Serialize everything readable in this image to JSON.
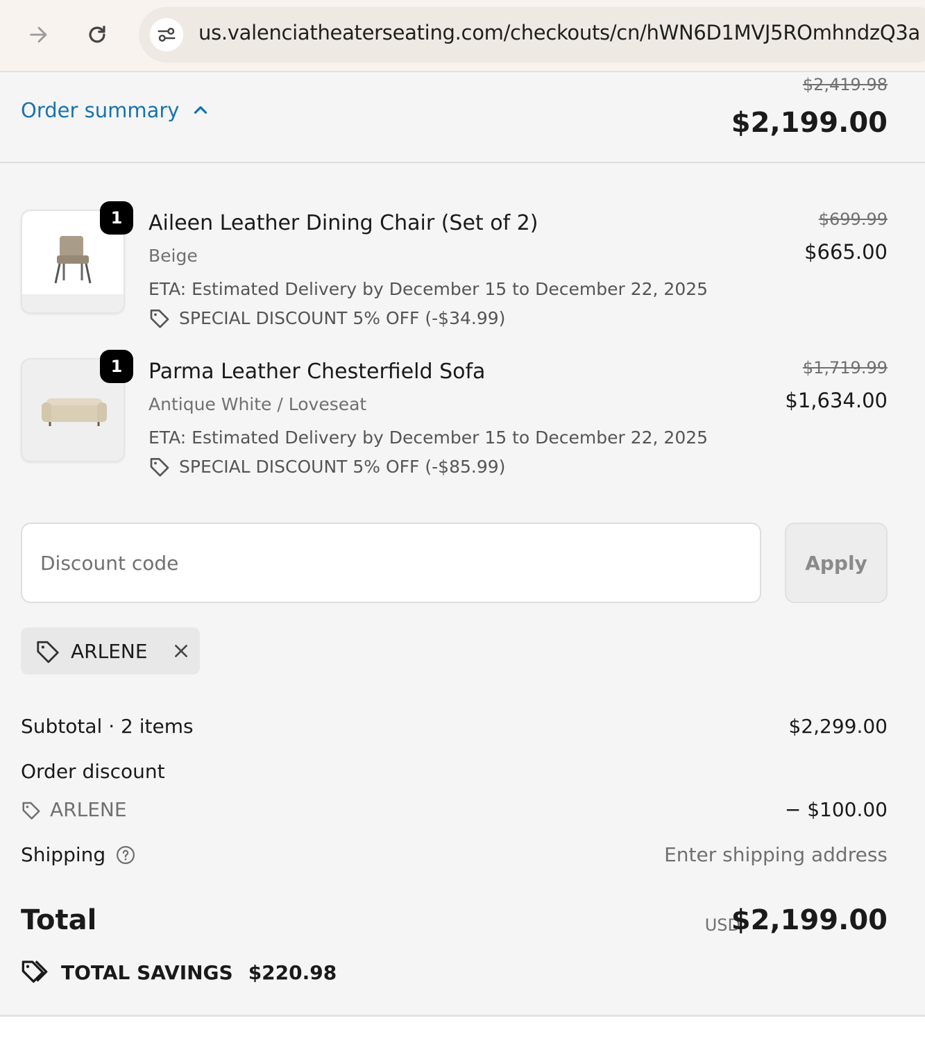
{
  "browser": {
    "url": "us.valenciatheaterseating.com/checkouts/cn/hWN6D1MVJ5ROmhndzQ3a"
  },
  "summary": {
    "toggle_label": "Order summary",
    "compare_total": "$2,419.98",
    "total": "$2,199.00"
  },
  "items": [
    {
      "quantity": "1",
      "name": "Aileen Leather Dining Chair (Set of 2)",
      "variant": "Beige",
      "eta": "ETA: Estimated Delivery by December 15 to December 22, 2025",
      "discount": "SPECIAL DISCOUNT 5% OFF (-$34.99)",
      "compare_price": "$699.99",
      "price": "$665.00",
      "image": "dining-chair"
    },
    {
      "quantity": "1",
      "name": "Parma Leather Chesterfield Sofa",
      "variant": "Antique White / Loveseat",
      "eta": "ETA: Estimated Delivery by December 15 to December 22, 2025",
      "discount": "SPECIAL DISCOUNT 5% OFF (-$85.99)",
      "compare_price": "$1,719.99",
      "price": "$1,634.00",
      "image": "chesterfield-sofa"
    }
  ],
  "discount_form": {
    "placeholder": "Discount code",
    "value": "",
    "apply_label": "Apply",
    "applied_code": "ARLENE"
  },
  "totals": {
    "subtotal_label": "Subtotal · 2 items",
    "subtotal_value": "$2,299.00",
    "order_discount_label": "Order discount",
    "discount_code": "ARLENE",
    "discount_amount": "− $100.00",
    "shipping_label": "Shipping",
    "shipping_value": "Enter shipping address",
    "total_label": "Total",
    "currency": "USD",
    "total_value": "$2,199.00",
    "savings_label": "TOTAL SAVINGS",
    "savings_value": "$220.98"
  },
  "colors": {
    "link": "#1773b0",
    "background": "#f5f5f5",
    "chrome": "#f9f3ef"
  },
  "icons": [
    "forward-arrow-icon",
    "reload-icon",
    "site-info-icon",
    "chevron-up-icon",
    "tag-icon",
    "close-icon",
    "help-icon",
    "savings-tags-icon"
  ]
}
